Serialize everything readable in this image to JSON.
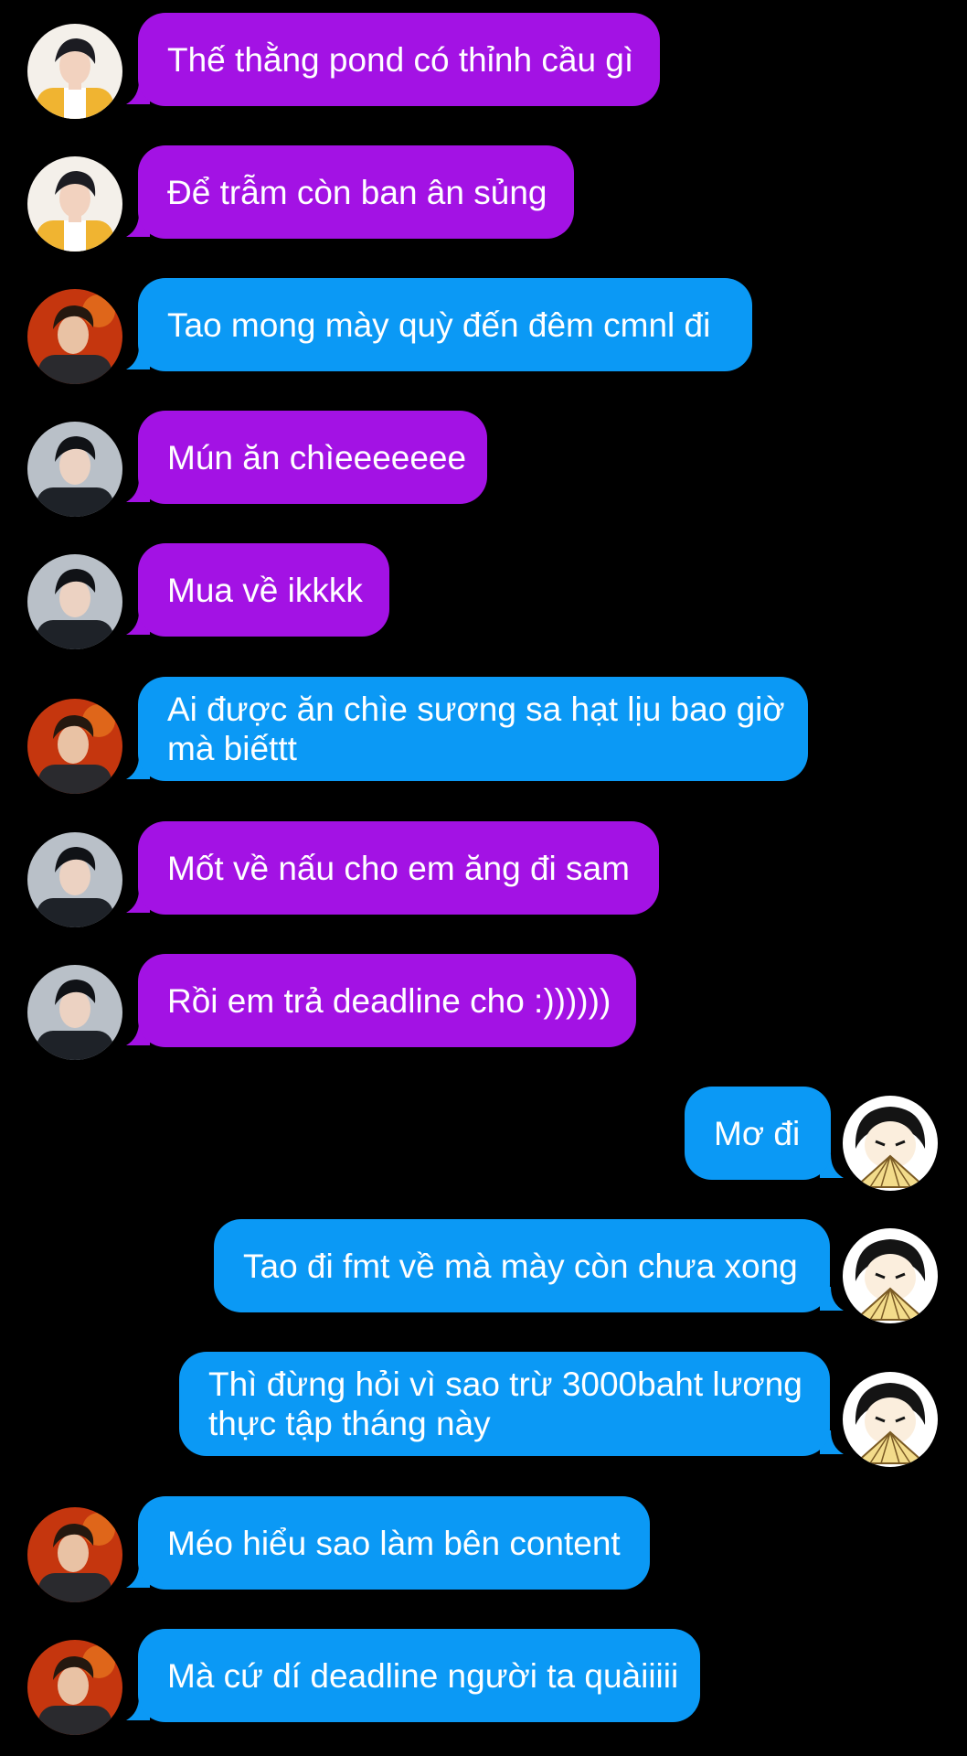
{
  "colors": {
    "background": "#000000",
    "bubble_purple": "#a312e4",
    "bubble_blue": "#0b99f5",
    "text": "#ffffff"
  },
  "messages": [
    {
      "side": "in",
      "avatar": "avatar-yellow-jacket",
      "color": "purple",
      "lines": [
        "Thế thằng pond có thỉnh cầu gì"
      ]
    },
    {
      "side": "in",
      "avatar": "avatar-yellow-jacket",
      "color": "purple",
      "lines": [
        "Để trẫm còn ban ân sủng"
      ]
    },
    {
      "side": "in",
      "avatar": "avatar-red-background",
      "color": "blue",
      "lines": [
        "Tao mong mày quỳ đến đêm cmnl đi"
      ]
    },
    {
      "side": "in",
      "avatar": "avatar-grey-background",
      "color": "purple",
      "lines": [
        "Mún ăn chìeeeeeee"
      ]
    },
    {
      "side": "in",
      "avatar": "avatar-grey-background",
      "color": "purple",
      "lines": [
        "Mua về ikkkk"
      ]
    },
    {
      "side": "in",
      "avatar": "avatar-red-background",
      "color": "blue",
      "lines": [
        "Ai được ăn chìe sương sa hạt lịu bao giờ",
        "mà biếttt"
      ]
    },
    {
      "side": "in",
      "avatar": "avatar-grey-background",
      "color": "purple",
      "lines": [
        "Mốt về nấu cho em ăng đi sam"
      ]
    },
    {
      "side": "in",
      "avatar": "avatar-grey-background",
      "color": "purple",
      "lines": [
        "Rồi em trả deadline cho :))))))"
      ]
    },
    {
      "side": "out",
      "avatar": "avatar-cartoon-fan",
      "color": "blue",
      "lines": [
        "Mơ đi"
      ]
    },
    {
      "side": "out",
      "avatar": "avatar-cartoon-fan",
      "color": "blue",
      "lines": [
        "Tao đi fmt về mà mày còn chưa xong"
      ]
    },
    {
      "side": "out",
      "avatar": "avatar-cartoon-fan",
      "color": "blue",
      "lines": [
        "Thì đừng hỏi vì sao trừ 3000baht lương",
        "thực tập tháng này"
      ]
    },
    {
      "side": "in",
      "avatar": "avatar-red-background",
      "color": "blue",
      "lines": [
        "Méo hiểu sao làm bên content"
      ]
    },
    {
      "side": "in",
      "avatar": "avatar-red-background",
      "color": "blue",
      "lines": [
        "Mà cứ dí deadline người ta quàiiiii"
      ]
    }
  ]
}
